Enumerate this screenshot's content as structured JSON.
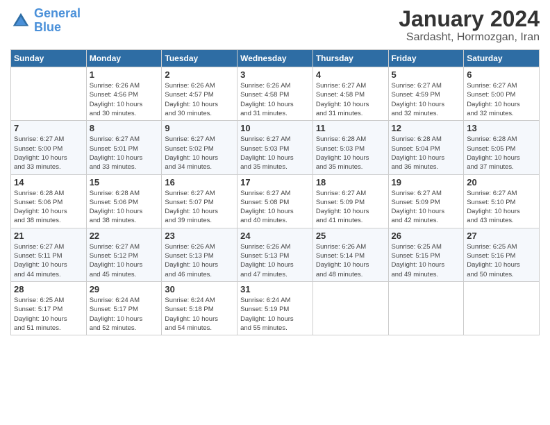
{
  "header": {
    "logo_line1": "General",
    "logo_line2": "Blue",
    "title": "January 2024",
    "subtitle": "Sardasht, Hormozgan, Iran"
  },
  "days_of_week": [
    "Sunday",
    "Monday",
    "Tuesday",
    "Wednesday",
    "Thursday",
    "Friday",
    "Saturday"
  ],
  "weeks": [
    [
      {
        "day": "",
        "info": ""
      },
      {
        "day": "1",
        "info": "Sunrise: 6:26 AM\nSunset: 4:56 PM\nDaylight: 10 hours\nand 30 minutes."
      },
      {
        "day": "2",
        "info": "Sunrise: 6:26 AM\nSunset: 4:57 PM\nDaylight: 10 hours\nand 30 minutes."
      },
      {
        "day": "3",
        "info": "Sunrise: 6:26 AM\nSunset: 4:58 PM\nDaylight: 10 hours\nand 31 minutes."
      },
      {
        "day": "4",
        "info": "Sunrise: 6:27 AM\nSunset: 4:58 PM\nDaylight: 10 hours\nand 31 minutes."
      },
      {
        "day": "5",
        "info": "Sunrise: 6:27 AM\nSunset: 4:59 PM\nDaylight: 10 hours\nand 32 minutes."
      },
      {
        "day": "6",
        "info": "Sunrise: 6:27 AM\nSunset: 5:00 PM\nDaylight: 10 hours\nand 32 minutes."
      }
    ],
    [
      {
        "day": "7",
        "info": "Sunrise: 6:27 AM\nSunset: 5:00 PM\nDaylight: 10 hours\nand 33 minutes."
      },
      {
        "day": "8",
        "info": "Sunrise: 6:27 AM\nSunset: 5:01 PM\nDaylight: 10 hours\nand 33 minutes."
      },
      {
        "day": "9",
        "info": "Sunrise: 6:27 AM\nSunset: 5:02 PM\nDaylight: 10 hours\nand 34 minutes."
      },
      {
        "day": "10",
        "info": "Sunrise: 6:27 AM\nSunset: 5:03 PM\nDaylight: 10 hours\nand 35 minutes."
      },
      {
        "day": "11",
        "info": "Sunrise: 6:28 AM\nSunset: 5:03 PM\nDaylight: 10 hours\nand 35 minutes."
      },
      {
        "day": "12",
        "info": "Sunrise: 6:28 AM\nSunset: 5:04 PM\nDaylight: 10 hours\nand 36 minutes."
      },
      {
        "day": "13",
        "info": "Sunrise: 6:28 AM\nSunset: 5:05 PM\nDaylight: 10 hours\nand 37 minutes."
      }
    ],
    [
      {
        "day": "14",
        "info": "Sunrise: 6:28 AM\nSunset: 5:06 PM\nDaylight: 10 hours\nand 38 minutes."
      },
      {
        "day": "15",
        "info": "Sunrise: 6:28 AM\nSunset: 5:06 PM\nDaylight: 10 hours\nand 38 minutes."
      },
      {
        "day": "16",
        "info": "Sunrise: 6:27 AM\nSunset: 5:07 PM\nDaylight: 10 hours\nand 39 minutes."
      },
      {
        "day": "17",
        "info": "Sunrise: 6:27 AM\nSunset: 5:08 PM\nDaylight: 10 hours\nand 40 minutes."
      },
      {
        "day": "18",
        "info": "Sunrise: 6:27 AM\nSunset: 5:09 PM\nDaylight: 10 hours\nand 41 minutes."
      },
      {
        "day": "19",
        "info": "Sunrise: 6:27 AM\nSunset: 5:09 PM\nDaylight: 10 hours\nand 42 minutes."
      },
      {
        "day": "20",
        "info": "Sunrise: 6:27 AM\nSunset: 5:10 PM\nDaylight: 10 hours\nand 43 minutes."
      }
    ],
    [
      {
        "day": "21",
        "info": "Sunrise: 6:27 AM\nSunset: 5:11 PM\nDaylight: 10 hours\nand 44 minutes."
      },
      {
        "day": "22",
        "info": "Sunrise: 6:27 AM\nSunset: 5:12 PM\nDaylight: 10 hours\nand 45 minutes."
      },
      {
        "day": "23",
        "info": "Sunrise: 6:26 AM\nSunset: 5:13 PM\nDaylight: 10 hours\nand 46 minutes."
      },
      {
        "day": "24",
        "info": "Sunrise: 6:26 AM\nSunset: 5:13 PM\nDaylight: 10 hours\nand 47 minutes."
      },
      {
        "day": "25",
        "info": "Sunrise: 6:26 AM\nSunset: 5:14 PM\nDaylight: 10 hours\nand 48 minutes."
      },
      {
        "day": "26",
        "info": "Sunrise: 6:25 AM\nSunset: 5:15 PM\nDaylight: 10 hours\nand 49 minutes."
      },
      {
        "day": "27",
        "info": "Sunrise: 6:25 AM\nSunset: 5:16 PM\nDaylight: 10 hours\nand 50 minutes."
      }
    ],
    [
      {
        "day": "28",
        "info": "Sunrise: 6:25 AM\nSunset: 5:17 PM\nDaylight: 10 hours\nand 51 minutes."
      },
      {
        "day": "29",
        "info": "Sunrise: 6:24 AM\nSunset: 5:17 PM\nDaylight: 10 hours\nand 52 minutes."
      },
      {
        "day": "30",
        "info": "Sunrise: 6:24 AM\nSunset: 5:18 PM\nDaylight: 10 hours\nand 54 minutes."
      },
      {
        "day": "31",
        "info": "Sunrise: 6:24 AM\nSunset: 5:19 PM\nDaylight: 10 hours\nand 55 minutes."
      },
      {
        "day": "",
        "info": ""
      },
      {
        "day": "",
        "info": ""
      },
      {
        "day": "",
        "info": ""
      }
    ]
  ]
}
